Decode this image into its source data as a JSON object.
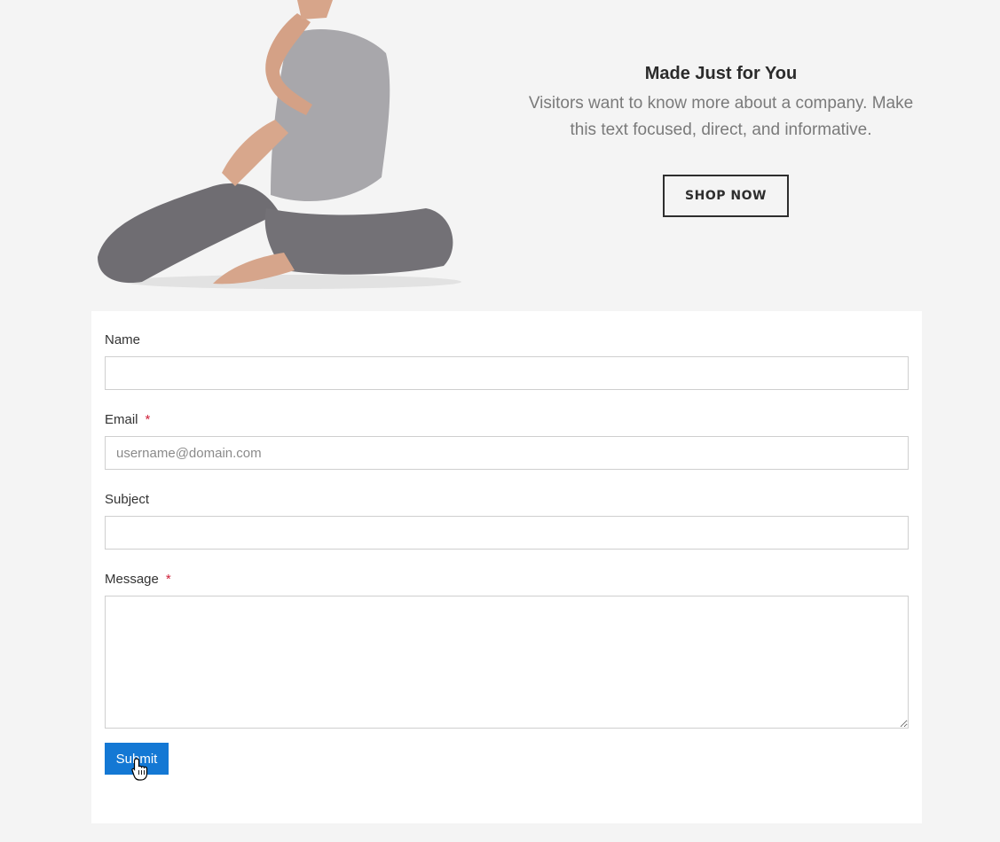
{
  "hero": {
    "title": "Made Just for You",
    "description": "Visitors want to know more about a company. Make this text focused, direct, and informative.",
    "cta_label": "SHOP NOW",
    "image_subject": "woman in yoga pose"
  },
  "form": {
    "fields": {
      "name": {
        "label": "Name",
        "value": "",
        "placeholder": ""
      },
      "email": {
        "label": "Email",
        "required_mark": "*",
        "value": "",
        "placeholder": "username@domain.com"
      },
      "subject": {
        "label": "Subject",
        "value": "",
        "placeholder": ""
      },
      "message": {
        "label": "Message",
        "required_mark": "*",
        "value": ""
      }
    },
    "submit_label": "Submit"
  },
  "colors": {
    "page_background": "#f4f4f4",
    "card_background": "#ffffff",
    "submit_button": "#1478d4",
    "required_mark": "#d0213a",
    "cta_border": "#2e2e2e"
  },
  "icons": {
    "cursor": "hand-pointer-icon"
  }
}
